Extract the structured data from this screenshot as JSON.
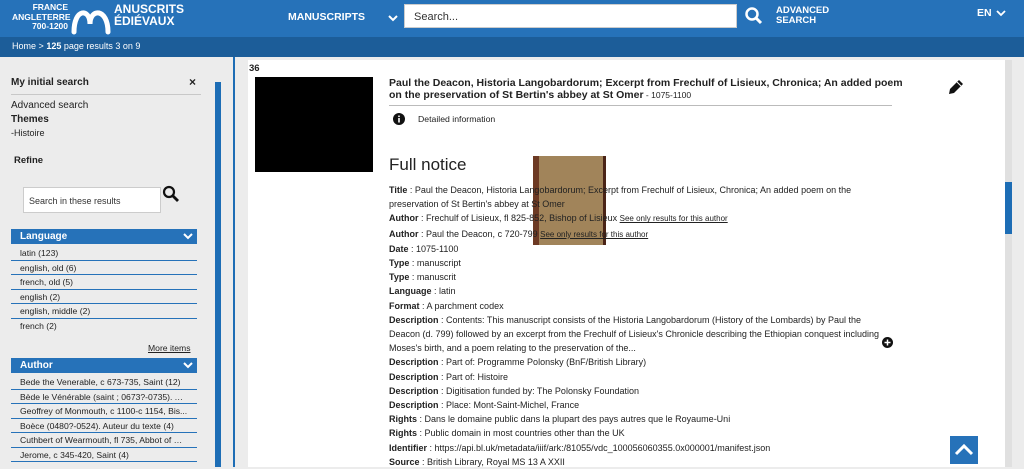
{
  "header": {
    "logo_left": [
      "FRANCE",
      "ANGLETERRE",
      "700-1200"
    ],
    "logo_right": [
      "ANUSCRITS",
      "ÉDIÉVAUX"
    ],
    "nav_manuscripts": "MANUSCRIPTS",
    "search_placeholder": "Search...",
    "advanced_lines": [
      "ADVANCED",
      "SEARCH"
    ],
    "lang": "EN"
  },
  "breadcrumb": {
    "home": "Home",
    "sep": ">",
    "count": "125",
    "rest": "page results 3 on 9"
  },
  "sidebar": {
    "initial_search": "My initial search",
    "close": "×",
    "advanced": "Advanced search",
    "themes": "Themes",
    "theme_value": "-Histoire",
    "refine": "Refine",
    "refine_placeholder": "Search in these results",
    "language": {
      "title": "Language",
      "items": [
        "latin (123)",
        "english, old (6)",
        "french, old (5)",
        "english (2)",
        "english, middle (2)",
        "french (2)"
      ]
    },
    "more": "More items",
    "author": {
      "title": "Author",
      "items": [
        "Bede the Venerable, c 673-735, Saint (12)",
        "Bède le Vénérable (saint ; 0673?-0735). Aut...",
        "Geoffrey of Monmouth, c 1100-c 1154, Bis...",
        "Boèce (0480?-0524). Auteur du texte (4)",
        "Cuthbert of Wearmouth, fl 735, Abbot of W...",
        "Jerome, c 345-420, Saint (4)"
      ]
    }
  },
  "record": {
    "number": "36",
    "title": "Paul the Deacon, Historia Langobardorum; Excerpt from Frechulf of Lisieux, Chronica; An added poem on the preservation of St Bertin's abbey at St Omer",
    "title_date": " - 1075-1100",
    "detail": "Detailed information",
    "full_notice": "Full notice",
    "fields": [
      {
        "k": "Title",
        "v": "Paul the Deacon, Historia Langobardorum; Excerpt from Frechulf of Lisieux, Chronica; An added poem on the preservation of St Bertin's abbey at St Omer",
        "see": ""
      },
      {
        "k": "Author",
        "v": "Frechulf of Lisieux, fl 825-852, Bishop of Lisieux",
        "see": "See only results for this author"
      },
      {
        "k": "Author",
        "v": "Paul the Deacon, c 720-799",
        "see": "See only results for this author"
      },
      {
        "k": "Date",
        "v": "1075-1100",
        "see": ""
      },
      {
        "k": "Type",
        "v": "manuscript",
        "see": ""
      },
      {
        "k": "Type",
        "v": "manuscrit",
        "see": ""
      },
      {
        "k": "Language",
        "v": "latin",
        "see": ""
      },
      {
        "k": "Format",
        "v": "A parchment codex",
        "see": ""
      },
      {
        "k": "Description",
        "v": "Contents: This manuscript consists of the Historia Langobardorum (History of the Lombards) by Paul the Deacon (d. 799) followed by an excerpt from the Frechulf of Lisieux's Chronicle describing the Ethiopian conquest including Moses's birth, and a poem relating to the preservation of the...",
        "see": ""
      },
      {
        "k": "Description",
        "v": "Part of: Programme Polonsky (BnF/British Library)",
        "see": ""
      },
      {
        "k": "Description",
        "v": "Part of: Histoire",
        "see": ""
      },
      {
        "k": "Description",
        "v": "Digitisation funded by: The Polonsky Foundation",
        "see": ""
      },
      {
        "k": "Description",
        "v": "Place: Mont-Saint-Michel, France",
        "see": ""
      },
      {
        "k": "Rights",
        "v": "Dans le domaine public dans la plupart des pays autres que le Royaume-Uni",
        "see": ""
      },
      {
        "k": "Rights",
        "v": "Public domain in most countries other than the UK",
        "see": ""
      },
      {
        "k": "Identifier",
        "v": "https://api.bl.uk/metadata/iiif/ark:/81055/vdc_100056060355.0x000001/manifest.json",
        "see": ""
      },
      {
        "k": "Source",
        "v": "British Library, Royal MS 13 A XXII",
        "see": ""
      }
    ]
  },
  "colors": {
    "brand": "#2672b9",
    "brand_dark": "#1c5d99"
  }
}
